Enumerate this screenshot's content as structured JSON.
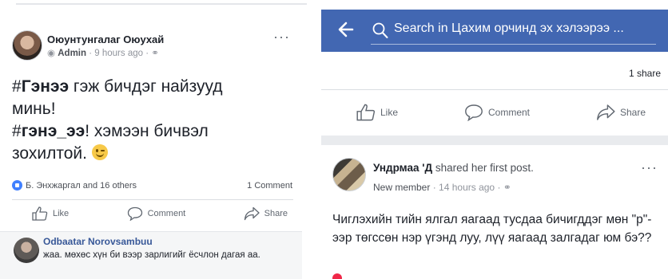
{
  "left_post": {
    "author": "Оюунтунгалаг Оюухай",
    "role": "Admin",
    "time": "9 hours ago",
    "separator": "·",
    "more": "···",
    "text_1_bold": "Гэнээ",
    "text_1_rest": " гэж бичдэг найзууд",
    "text_2": "минь!",
    "text_3_prefix": "#",
    "text_3_bold": "гэнэ_ээ",
    "text_3_rest": "! хэмээн бичвэл",
    "text_4": "зохилтой.",
    "hash": "#",
    "reactions": "Б. Энхжаргал and 16 others",
    "comments": "1 Comment",
    "actions": {
      "like": "Like",
      "comment": "Comment",
      "share": "Share"
    }
  },
  "left_comment": {
    "author": "Odbaatar Norovsambuu",
    "text": "жаа. мөхөс хүн би вээр зарлигийг ёсчлон дагая аа."
  },
  "right_panel": {
    "search_placeholder": "Search in Цахим орчинд эх хэлээрээ ...",
    "shares": "1 share",
    "actions": {
      "like": "Like",
      "comment": "Comment",
      "share": "Share"
    },
    "post": {
      "author": "Ундрмаа 'Д",
      "action_text": " shared her first post.",
      "role": "New member",
      "time": "14 hours ago",
      "separator": "·",
      "more": "···",
      "text": "Чиглэхийн тийн ялгал яагаад тусдаа бичигддэг мөн \"р\"-ээр төгссөн нэр үгэнд луу, лүү яагаад залгадаг юм бэ??"
    }
  },
  "colors": {
    "topbar": "#4267b2",
    "link": "#385898",
    "like_badge": "#4080ff"
  },
  "icons": [
    "back-arrow-icon",
    "search-icon",
    "like-icon",
    "comment-icon",
    "share-icon",
    "globe-icon",
    "admin-shield-icon",
    "wink-emoji-icon"
  ]
}
